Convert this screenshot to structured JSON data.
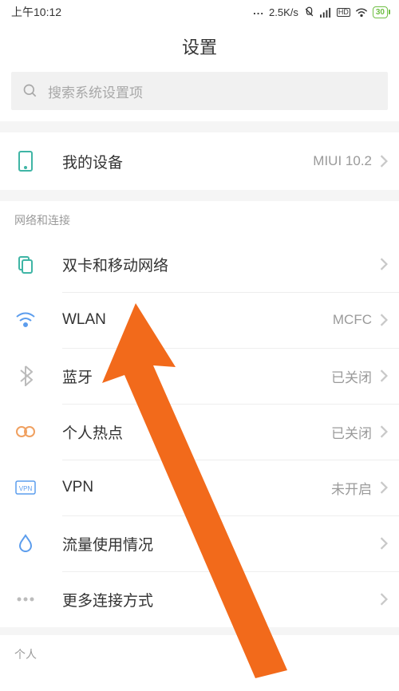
{
  "statusBar": {
    "time": "上午10:12",
    "dots": "...",
    "speed": "2.5K/s",
    "hdLabel": "HD",
    "batteryPct": "30"
  },
  "header": {
    "title": "设置"
  },
  "search": {
    "placeholder": "搜索系统设置项"
  },
  "device": {
    "label": "我的设备",
    "value": "MIUI 10.2"
  },
  "sections": {
    "network": {
      "header": "网络和连接",
      "items": [
        {
          "label": "双卡和移动网络",
          "value": ""
        },
        {
          "label": "WLAN",
          "value": "MCFC"
        },
        {
          "label": "蓝牙",
          "value": "已关闭"
        },
        {
          "label": "个人热点",
          "value": "已关闭"
        },
        {
          "label": "VPN",
          "value": "未开启"
        },
        {
          "label": "流量使用情况",
          "value": ""
        },
        {
          "label": "更多连接方式",
          "value": ""
        }
      ]
    },
    "personal": {
      "header": "个人"
    }
  },
  "colors": {
    "iconTeal": "#3fb5a5",
    "iconBlue": "#5c9ded",
    "iconGray": "#bcbcbc",
    "iconOrange": "#f0a060",
    "arrowOrange": "#f26a1b",
    "batteryGreen": "#6fbf44"
  }
}
